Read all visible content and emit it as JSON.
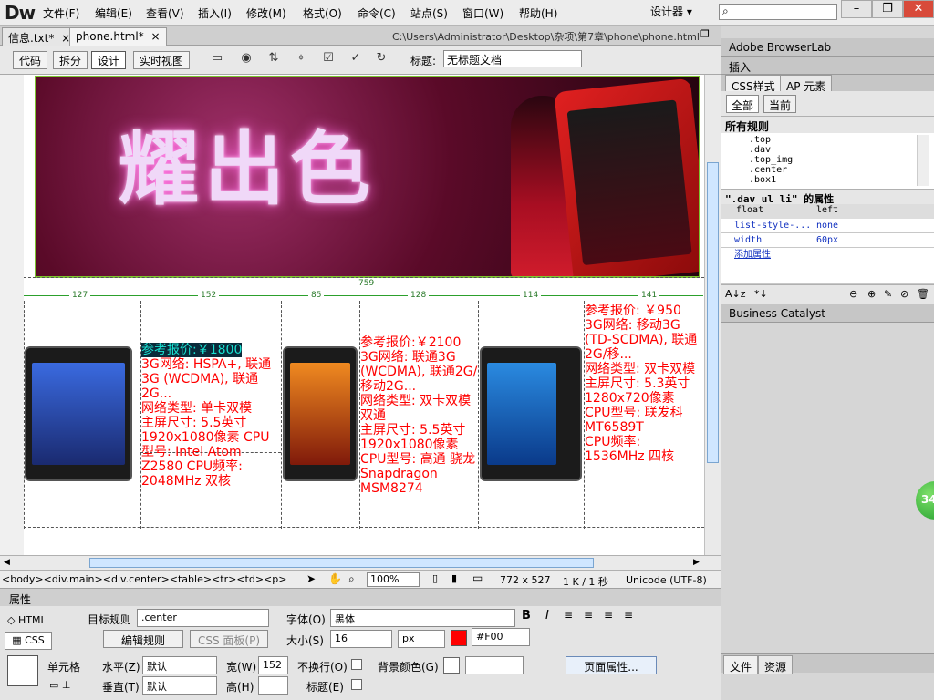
{
  "app": {
    "logo": "Dw",
    "menu": [
      "文件(F)",
      "编辑(E)",
      "查看(V)",
      "插入(I)",
      "修改(M)",
      "格式(O)",
      "命令(C)",
      "站点(S)",
      "窗口(W)",
      "帮助(H)"
    ],
    "mode": "设计器 ▾",
    "search_placeholder": "",
    "win_min": "–",
    "win_max": "❐",
    "win_close": "✕"
  },
  "tabs": [
    {
      "label": "信息.txt*",
      "close": "×"
    },
    {
      "label": "phone.html*",
      "close": "×"
    }
  ],
  "file_path": "C:\\Users\\Administrator\\Desktop\\杂项\\第7章\\phone\\phone.html",
  "toolbar": {
    "views": [
      "代码",
      "拆分",
      "设计",
      "实时视图"
    ],
    "title_label": "标题:",
    "title_value": "无标题文档"
  },
  "banner": {
    "word": "耀出色"
  },
  "ruler": {
    "total": "759",
    "cols": [
      "127",
      "152",
      "85",
      "128",
      "114",
      "141"
    ]
  },
  "products": [
    {
      "price": "参考报价:￥1800",
      "lines": [
        "3G网络: HSPA+, 联通3G (WCDMA), 联通2G...",
        "网络类型: 单卡双模",
        "主屏尺寸: 5.5英寸 1920x1080像素 CPU型号: Intel Atom Z2580 CPU频率: 2048MHz 双核"
      ]
    },
    {
      "price": "参考报价:￥2100",
      "lines": [
        "3G网络: 联通3G (WCDMA), 联通2G/移动2G...",
        "网络类型: 双卡双模双通",
        "主屏尺寸: 5.5英寸 1920x1080像素",
        "CPU型号: 高通 骁龙Snapdragon MSM8274"
      ]
    },
    {
      "price": "参考报价: ￥950",
      "lines": [
        "3G网络: 移动3G (TD-SCDMA), 联通2G/移...",
        "网络类型: 双卡双模",
        "主屏尺寸: 5.3英寸 1280x720像素",
        "CPU型号: 联发科 MT6589T",
        "CPU频率: 1536MHz 四核"
      ]
    }
  ],
  "status": {
    "tags": "<body><div.main><div.center><table><tr><td><p>",
    "zoom": "100%",
    "dims": "772 x 527",
    "speed": "1 K / 1 秒",
    "encoding": "Unicode (UTF-8)"
  },
  "props": {
    "panel_title": "属性",
    "html_btn": "HTML",
    "css_btn": "CSS",
    "target_rule_label": "目标规则",
    "target_rule_value": ".center",
    "edit_rule": "编辑规则",
    "css_panel": "CSS 面板(P)",
    "font_label": "字体(O)",
    "font_value": "黑体",
    "size_label": "大小(S)",
    "size_value": "16",
    "size_unit": "px",
    "color_value": "#F00",
    "color": "#ff0000",
    "bold": "B",
    "italic": "I",
    "cell_label": "单元格",
    "horz_label": "水平(Z)",
    "horz_value": "默认",
    "vert_label": "垂直(T)",
    "vert_value": "默认",
    "width_label": "宽(W)",
    "width_value": "152",
    "height_label": "高(H)",
    "height_value": "",
    "nowrap_label": "不换行(O)",
    "header_label": "标题(E)",
    "bg_label": "背景颜色(G)",
    "page_props": "页面属性..."
  },
  "right_panel": {
    "browserlab": "Adobe BrowserLab",
    "insert": "插入",
    "css_tab": "CSS样式",
    "ap_tab": "AP 元素",
    "all_btn": "全部",
    "current_btn": "当前",
    "all_rules": "所有规则",
    "rules": [
      ".top",
      ".dav",
      ".top_img",
      ".center",
      ".box1"
    ],
    "props_title": "\".dav ul li\" 的属性",
    "props": [
      {
        "name": "float",
        "value": "left"
      },
      {
        "name": "list-style-...",
        "value": "none"
      },
      {
        "name": "width",
        "value": "60px"
      }
    ],
    "add_prop": "添加属性",
    "catalyst": "Business Catalyst",
    "bottom_tabs": [
      "文件",
      "资源"
    ]
  },
  "badge": "34"
}
